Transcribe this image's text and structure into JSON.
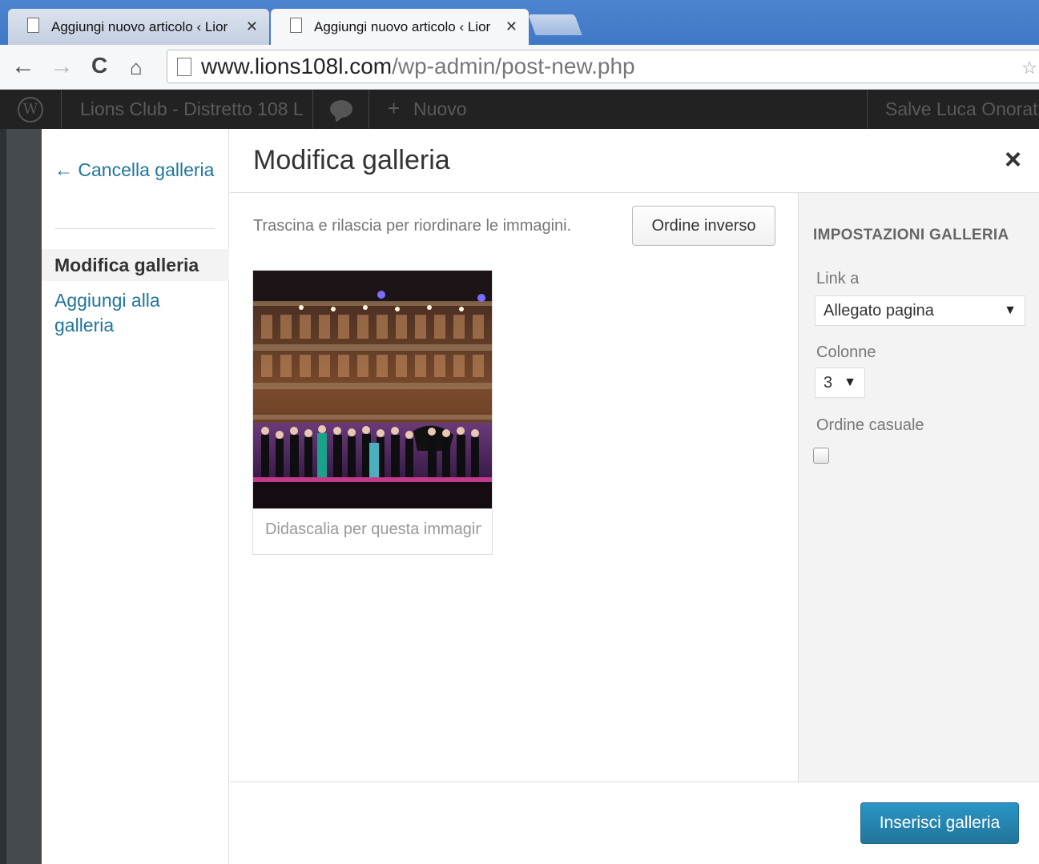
{
  "browser": {
    "tabs": [
      {
        "label": "Aggiungi nuovo articolo ‹ Lior",
        "close": "✕",
        "active": false
      },
      {
        "label": "Aggiungi nuovo articolo ‹ Lior",
        "close": "✕",
        "active": true
      }
    ],
    "url_host": "www.lions108l.com",
    "url_path": "/wp-admin/post-new.php"
  },
  "adminbar": {
    "site_name": "Lions Club - Distretto 108 L",
    "new_label": "Nuovo",
    "greeting": "Salve Luca Onorati"
  },
  "menu": {
    "back": "← Cancella galleria",
    "active": "Modifica galleria",
    "add": "Aggiungi alla galleria"
  },
  "modal": {
    "title": "Modifica galleria",
    "hint": "Trascina e rilascia per riordinare le immagini.",
    "reverse_button": "Ordine inverso",
    "attachment_caption_placeholder": "Didascalia per questa immagine",
    "insert_button": "Inserisci galleria"
  },
  "settings": {
    "heading": "IMPOSTAZIONI GALLERIA",
    "link_label": "Link a",
    "link_value": "Allegato pagina",
    "columns_label": "Colonne",
    "columns_value": "3",
    "random_label": "Ordine casuale",
    "random_checked": false
  },
  "colors": {
    "link": "#21759b",
    "primary_button": "#21759b",
    "adminbar": "#222222",
    "sidebar_bg": "#f3f3f3",
    "tabbar": "#4d84cf"
  }
}
